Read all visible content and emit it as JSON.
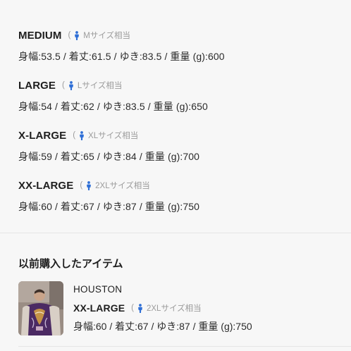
{
  "sizes": [
    {
      "name": "MEDIUM",
      "paren": "(",
      "hint": "Mサイズ相当",
      "measurements": "身幅:53.5 / 着丈:61.5 / ゆき:83.5 / 重量 (g):600"
    },
    {
      "name": "LARGE",
      "paren": "(",
      "hint": "Lサイズ相当",
      "measurements": "身幅:54 / 着丈:62 / ゆき:83.5 / 重量 (g):650"
    },
    {
      "name": "X-LARGE",
      "paren": "(",
      "hint": "XLサイズ相当",
      "measurements": "身幅:59 / 着丈:65 / ゆき:84 / 重量 (g):700"
    },
    {
      "name": "XX-LARGE",
      "paren": "(",
      "hint": "2XLサイズ相当",
      "measurements": "身幅:60 / 着丈:67 / ゆき:87 / 重量 (g):750"
    }
  ],
  "previous": {
    "title": "以前購入したアイテム",
    "brand": "HOUSTON",
    "size": "XX-LARGE",
    "paren": "(",
    "hint": "2XLサイズ相当",
    "measurements": "身幅:60 / 着丈:67 / ゆき:87 / 重量 (g):750"
  },
  "colors": {
    "person_icon": "#2f6fd6",
    "hint_text": "#9b9b9b",
    "background": "#f7f7f7"
  }
}
